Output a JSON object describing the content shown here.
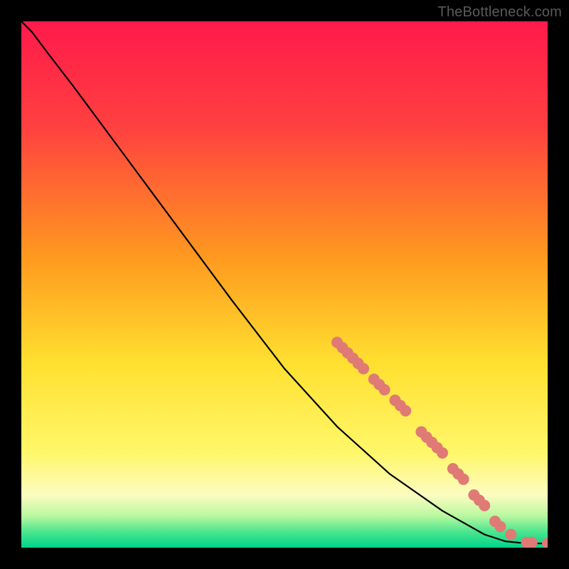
{
  "watermark": "TheBottleneck.com",
  "chart_data": {
    "type": "line",
    "title": "",
    "xlabel": "",
    "ylabel": "",
    "xlim": [
      0,
      100
    ],
    "ylim": [
      0,
      100
    ],
    "gradient_stops": [
      {
        "pct": 0,
        "color": "#ff1a4b"
      },
      {
        "pct": 20,
        "color": "#ff4040"
      },
      {
        "pct": 45,
        "color": "#ff9a1f"
      },
      {
        "pct": 65,
        "color": "#ffe030"
      },
      {
        "pct": 82,
        "color": "#fff76a"
      },
      {
        "pct": 90,
        "color": "#fcfcc0"
      },
      {
        "pct": 94,
        "color": "#b8f8a0"
      },
      {
        "pct": 97,
        "color": "#4be58e"
      },
      {
        "pct": 100,
        "color": "#00d48a"
      }
    ],
    "curve": [
      {
        "x": 0,
        "y": 100
      },
      {
        "x": 2,
        "y": 98
      },
      {
        "x": 5,
        "y": 94
      },
      {
        "x": 10,
        "y": 87.5
      },
      {
        "x": 20,
        "y": 74
      },
      {
        "x": 30,
        "y": 60.5
      },
      {
        "x": 40,
        "y": 47
      },
      {
        "x": 50,
        "y": 34
      },
      {
        "x": 60,
        "y": 23
      },
      {
        "x": 70,
        "y": 14
      },
      {
        "x": 80,
        "y": 7
      },
      {
        "x": 88,
        "y": 2.5
      },
      {
        "x": 92,
        "y": 1.2
      },
      {
        "x": 96,
        "y": 0.8
      },
      {
        "x": 100,
        "y": 0.8
      }
    ],
    "marker_color": "#e07a74",
    "marker_radius_px": 8,
    "markers": [
      {
        "x": 60,
        "y": 39
      },
      {
        "x": 61,
        "y": 38
      },
      {
        "x": 62,
        "y": 37
      },
      {
        "x": 63,
        "y": 36
      },
      {
        "x": 64,
        "y": 35
      },
      {
        "x": 65,
        "y": 34
      },
      {
        "x": 67,
        "y": 32
      },
      {
        "x": 68,
        "y": 31
      },
      {
        "x": 69,
        "y": 30
      },
      {
        "x": 71,
        "y": 28
      },
      {
        "x": 72,
        "y": 27
      },
      {
        "x": 73,
        "y": 26
      },
      {
        "x": 76,
        "y": 22
      },
      {
        "x": 77,
        "y": 21
      },
      {
        "x": 78,
        "y": 20
      },
      {
        "x": 79,
        "y": 19
      },
      {
        "x": 80,
        "y": 18
      },
      {
        "x": 82,
        "y": 15
      },
      {
        "x": 83,
        "y": 14
      },
      {
        "x": 84,
        "y": 13
      },
      {
        "x": 86,
        "y": 10
      },
      {
        "x": 87,
        "y": 9
      },
      {
        "x": 88,
        "y": 8
      },
      {
        "x": 90,
        "y": 5
      },
      {
        "x": 91,
        "y": 4
      },
      {
        "x": 93,
        "y": 2.5
      },
      {
        "x": 96,
        "y": 1.0
      },
      {
        "x": 97,
        "y": 1.0
      },
      {
        "x": 100,
        "y": 0.8
      }
    ]
  }
}
